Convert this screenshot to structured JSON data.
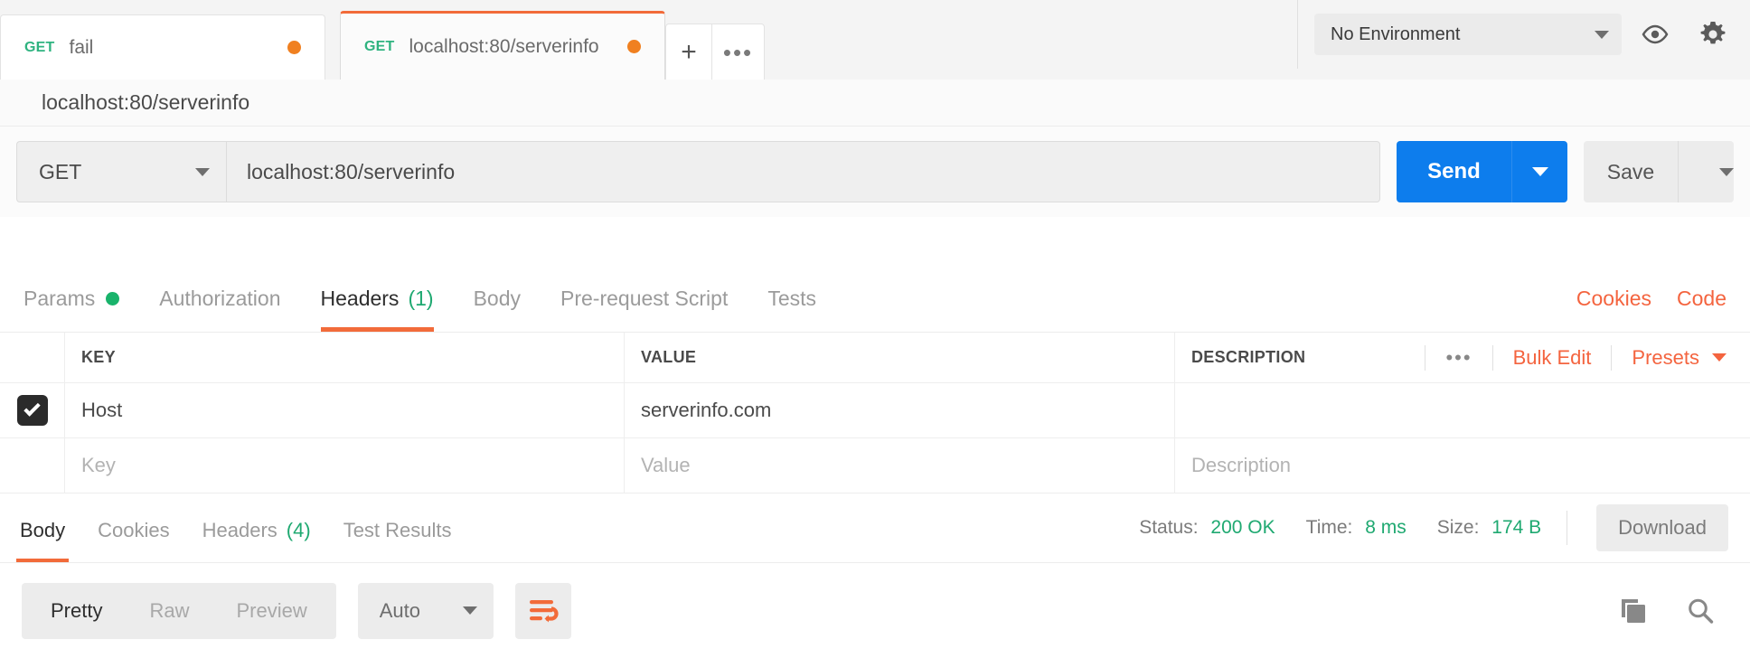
{
  "tabs": [
    {
      "method": "GET",
      "name": "fail",
      "active": false,
      "unsaved": true
    },
    {
      "method": "GET",
      "name": "localhost:80/serverinfo",
      "active": true,
      "unsaved": true
    }
  ],
  "tab_actions": {
    "new_tab": "+",
    "more": "•••"
  },
  "environment": {
    "label": "No Environment",
    "eye_icon": "eye-icon",
    "gear_icon": "gear-icon"
  },
  "request": {
    "name": "localhost:80/serverinfo",
    "method": "GET",
    "url": "localhost:80/serverinfo",
    "send_label": "Send",
    "save_label": "Save"
  },
  "request_tabs": [
    {
      "label": "Params",
      "badge": "",
      "dot": true,
      "active": false
    },
    {
      "label": "Authorization",
      "badge": "",
      "dot": false,
      "active": false
    },
    {
      "label": "Headers",
      "badge": "(1)",
      "dot": false,
      "active": true
    },
    {
      "label": "Body",
      "badge": "",
      "dot": false,
      "active": false
    },
    {
      "label": "Pre-request Script",
      "badge": "",
      "dot": false,
      "active": false
    },
    {
      "label": "Tests",
      "badge": "",
      "dot": false,
      "active": false
    }
  ],
  "request_tabs_right": [
    {
      "label": "Cookies"
    },
    {
      "label": "Code"
    }
  ],
  "headers_table": {
    "columns": [
      "KEY",
      "VALUE",
      "DESCRIPTION"
    ],
    "actions": {
      "more": "•••",
      "bulk_edit": "Bulk Edit",
      "presets": "Presets"
    },
    "rows": [
      {
        "checked": true,
        "key": "Host",
        "value": "serverinfo.com",
        "description": ""
      }
    ],
    "new_row_placeholders": {
      "key": "Key",
      "value": "Value",
      "description": "Description"
    }
  },
  "response_tabs": [
    {
      "label": "Body",
      "badge": "",
      "active": true
    },
    {
      "label": "Cookies",
      "badge": "",
      "active": false
    },
    {
      "label": "Headers",
      "badge": "(4)",
      "active": false
    },
    {
      "label": "Test Results",
      "badge": "",
      "active": false
    }
  ],
  "response_meta": {
    "status_label": "Status:",
    "status_value": "200 OK",
    "time_label": "Time:",
    "time_value": "8 ms",
    "size_label": "Size:",
    "size_value": "174 B",
    "download_label": "Download"
  },
  "body_toolbar": {
    "views": [
      {
        "label": "Pretty",
        "active": true
      },
      {
        "label": "Raw",
        "active": false
      },
      {
        "label": "Preview",
        "active": false
      }
    ],
    "language": "Auto",
    "wrap_icon": "word-wrap-icon",
    "copy_icon": "copy-icon",
    "search_icon": "search-icon"
  },
  "colors": {
    "accent_orange": "#f26b3a",
    "link_orange": "#f4643f",
    "send_blue": "#0d7ded",
    "success_green": "#1fa971",
    "method_green": "#2fb380",
    "unsaved_dot": "#f08020"
  }
}
